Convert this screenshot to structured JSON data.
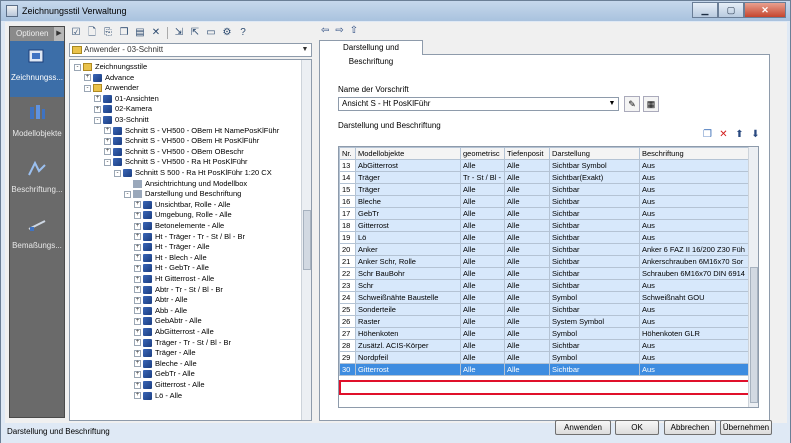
{
  "window": {
    "title": "Zeichnungsstil Verwaltung"
  },
  "sidebar": {
    "header": "Optionen",
    "items": [
      {
        "label": "Zeichnungss...",
        "icon": "drawing-style-icon",
        "active": true
      },
      {
        "label": "Modellobjekte",
        "icon": "model-objects-icon",
        "active": false
      },
      {
        "label": "Beschriftung...",
        "icon": "annotation-icon",
        "active": false
      },
      {
        "label": "Bemaßungs...",
        "icon": "dimension-icon",
        "active": false
      }
    ]
  },
  "tree": {
    "combo_value": "Anwender - 03-Schnitt",
    "nodes": [
      {
        "label": "Zeichnungsstile",
        "level": 0,
        "icon": "folder",
        "expander": "-"
      },
      {
        "label": "Advance",
        "level": 1,
        "icon": "blue",
        "expander": "+"
      },
      {
        "label": "Anwender",
        "level": 1,
        "icon": "folder",
        "expander": "-"
      },
      {
        "label": "01-Ansichten",
        "level": 2,
        "icon": "blue",
        "expander": "+"
      },
      {
        "label": "02-Kamera",
        "level": 2,
        "icon": "blue",
        "expander": "+"
      },
      {
        "label": "03-Schnitt",
        "level": 2,
        "icon": "blue",
        "expander": "-"
      },
      {
        "label": "Schnitt S - VH500 - OBem Ht NamePosKlFühr",
        "level": 3,
        "icon": "blue",
        "expander": "+"
      },
      {
        "label": "Schnitt S - VH500 - OBem Ht PosKlFühr",
        "level": 3,
        "icon": "blue",
        "expander": "+"
      },
      {
        "label": "Schnitt S - VH500 - OBem OBeschr",
        "level": 3,
        "icon": "blue",
        "expander": "+"
      },
      {
        "label": "Schnitt S - VH500 - Ra Ht PosKlFühr",
        "level": 3,
        "icon": "blue",
        "expander": "-"
      },
      {
        "label": "Schnitt S 500 - Ra Ht PosKlFühr 1:20 CX",
        "level": 4,
        "icon": "blue",
        "expander": "-"
      },
      {
        "label": "Ansichtrichtung und Modellbox",
        "level": 5,
        "icon": "gray",
        "expander": ""
      },
      {
        "label": "Darstellung und Beschriftung",
        "level": 5,
        "icon": "gray",
        "expander": "-"
      },
      {
        "label": "Unsichtbar, Rolle - Alle",
        "level": 6,
        "icon": "blue",
        "expander": "+"
      },
      {
        "label": "Umgebung, Rolle - Alle",
        "level": 6,
        "icon": "blue",
        "expander": "+"
      },
      {
        "label": "Betonelemente - Alle",
        "level": 6,
        "icon": "blue",
        "expander": "+"
      },
      {
        "label": "Ht - Träger - Tr - St / Bl - Br",
        "level": 6,
        "icon": "blue",
        "expander": "+"
      },
      {
        "label": "Ht - Träger - Alle",
        "level": 6,
        "icon": "blue",
        "expander": "+"
      },
      {
        "label": "Ht - Blech - Alle",
        "level": 6,
        "icon": "blue",
        "expander": "+"
      },
      {
        "label": "Ht - GebTr - Alle",
        "level": 6,
        "icon": "blue",
        "expander": "+"
      },
      {
        "label": "Ht Gitterrost - Alle",
        "level": 6,
        "icon": "blue",
        "expander": "+"
      },
      {
        "label": "Abtr - Tr - St / Bl - Br",
        "level": 6,
        "icon": "blue",
        "expander": "+"
      },
      {
        "label": "Abtr - Alle",
        "level": 6,
        "icon": "blue",
        "expander": "+"
      },
      {
        "label": "Abb - Alle",
        "level": 6,
        "icon": "blue",
        "expander": "+"
      },
      {
        "label": "GebAbtr - Alle",
        "level": 6,
        "icon": "blue",
        "expander": "+"
      },
      {
        "label": "AbGitterrost - Alle",
        "level": 6,
        "icon": "blue",
        "expander": "+"
      },
      {
        "label": "Träger - Tr - St / Bl - Br",
        "level": 6,
        "icon": "blue",
        "expander": "+"
      },
      {
        "label": "Träger - Alle",
        "level": 6,
        "icon": "blue",
        "expander": "+"
      },
      {
        "label": "Bleche - Alle",
        "level": 6,
        "icon": "blue",
        "expander": "+"
      },
      {
        "label": "GebTr - Alle",
        "level": 6,
        "icon": "blue",
        "expander": "+"
      },
      {
        "label": "Gitterrost - Alle",
        "level": 6,
        "icon": "blue",
        "expander": "+"
      },
      {
        "label": "Lö - Alle",
        "level": 6,
        "icon": "blue",
        "expander": "+"
      }
    ]
  },
  "panel": {
    "tab_label": "Darstellung und Beschriftung",
    "name_label": "Name der Vorschrift",
    "name_value": "Ansicht S - Ht PosKlFühr",
    "section_label": "Darstellung und Beschriftung"
  },
  "grid": {
    "columns": [
      "Nr.",
      "Modellobjekte",
      "geometrisc",
      "Tiefenposit",
      "Darstellung",
      "Beschriftung"
    ],
    "rows": [
      [
        "13",
        "AbGitterrost",
        "Alle",
        "Alle",
        "Sichtbar Symbol",
        "Aus"
      ],
      [
        "14",
        "Träger",
        "Tr - St / Bl -",
        "Alle",
        "Sichtbar(Exakt)",
        "Aus"
      ],
      [
        "15",
        "Träger",
        "Alle",
        "Alle",
        "Sichtbar",
        "Aus"
      ],
      [
        "16",
        "Bleche",
        "Alle",
        "Alle",
        "Sichtbar",
        "Aus"
      ],
      [
        "17",
        "GebTr",
        "Alle",
        "Alle",
        "Sichtbar",
        "Aus"
      ],
      [
        "18",
        "Gitterrost",
        "Alle",
        "Alle",
        "Sichtbar",
        "Aus"
      ],
      [
        "19",
        "Lö",
        "Alle",
        "Alle",
        "Sichtbar",
        "Aus"
      ],
      [
        "20",
        "Anker",
        "Alle",
        "Alle",
        "Sichtbar",
        "Anker 6 FAZ II 16/200 Z30 Füh"
      ],
      [
        "21",
        "Anker Schr, Rolle",
        "Alle",
        "Alle",
        "Sichtbar",
        "Ankerschrauben 6M16x70 Sor"
      ],
      [
        "22",
        "Schr BauBohr",
        "Alle",
        "Alle",
        "Sichtbar",
        "Schrauben 6M16x70 DIN 6914"
      ],
      [
        "23",
        "Schr",
        "Alle",
        "Alle",
        "Sichtbar",
        "Aus"
      ],
      [
        "24",
        "Schweißnähte Baustelle",
        "Alle",
        "Alle",
        "Symbol",
        "Schweißnaht GOU"
      ],
      [
        "25",
        "Sonderteile",
        "Alle",
        "Alle",
        "Sichtbar",
        "Aus"
      ],
      [
        "26",
        "Raster",
        "Alle",
        "Alle",
        "System Symbol",
        "Aus"
      ],
      [
        "27",
        "Höhenkoten",
        "Alle",
        "Alle",
        "Symbol",
        "Höhenkoten GLR"
      ],
      [
        "28",
        "Zusätzl. ACIS-Körper",
        "Alle",
        "Alle",
        "Sichtbar",
        "Aus"
      ],
      [
        "29",
        "Nordpfeil",
        "Alle",
        "Alle",
        "Symbol",
        "Aus"
      ],
      [
        "30",
        "Gitterrost",
        "Alle",
        "Alle",
        "Sichtbar",
        "Aus"
      ]
    ],
    "selected_index": 17
  },
  "status": {
    "text": "Darstellung und Beschriftung"
  },
  "buttons": {
    "apply": "Anwenden",
    "ok": "OK",
    "cancel": "Abbrechen",
    "accept": "Übernehmen"
  },
  "colors": {
    "selection": "#3d8ce0",
    "highlight_border": "#e0102a",
    "row_fill": "#d7e8fb"
  }
}
